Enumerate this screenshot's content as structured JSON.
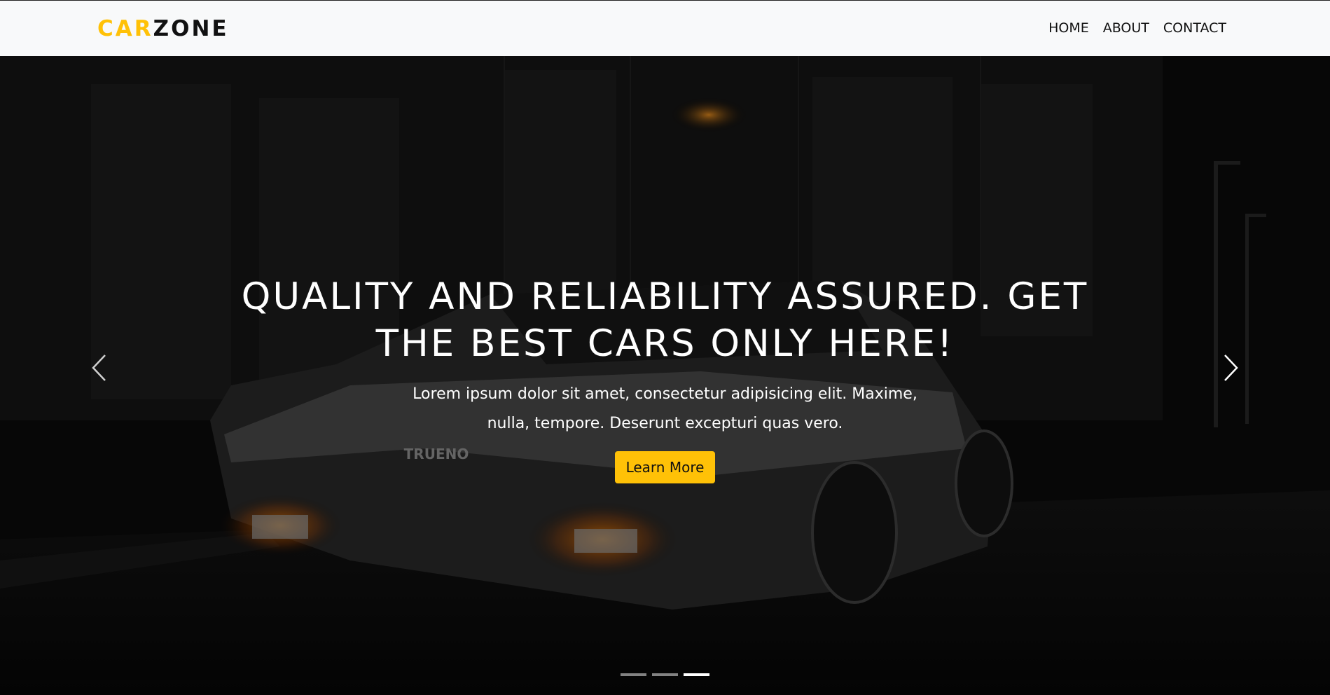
{
  "brand": {
    "part1": "CAR",
    "part2": "ZONE"
  },
  "nav": [
    {
      "label": "HOME"
    },
    {
      "label": "ABOUT"
    },
    {
      "label": "CONTACT"
    }
  ],
  "hero": {
    "title": "QUALITY AND RELIABILITY ASSURED. GET THE BEST CARS ONLY HERE!",
    "text": "Lorem ipsum dolor sit amet, consectetur adipisicing elit. Maxime, nulla, tempore. Deserunt excepturi quas vero.",
    "button_label": "Learn More",
    "plate_text": "TRUENO",
    "active_slide": 3,
    "slide_count": 3
  },
  "icons": {
    "prev": "chevron-left-icon",
    "next": "chevron-right-icon"
  },
  "colors": {
    "accent": "#ffc107",
    "navbar_bg": "#f8f9fa",
    "text_dark": "#111111"
  }
}
